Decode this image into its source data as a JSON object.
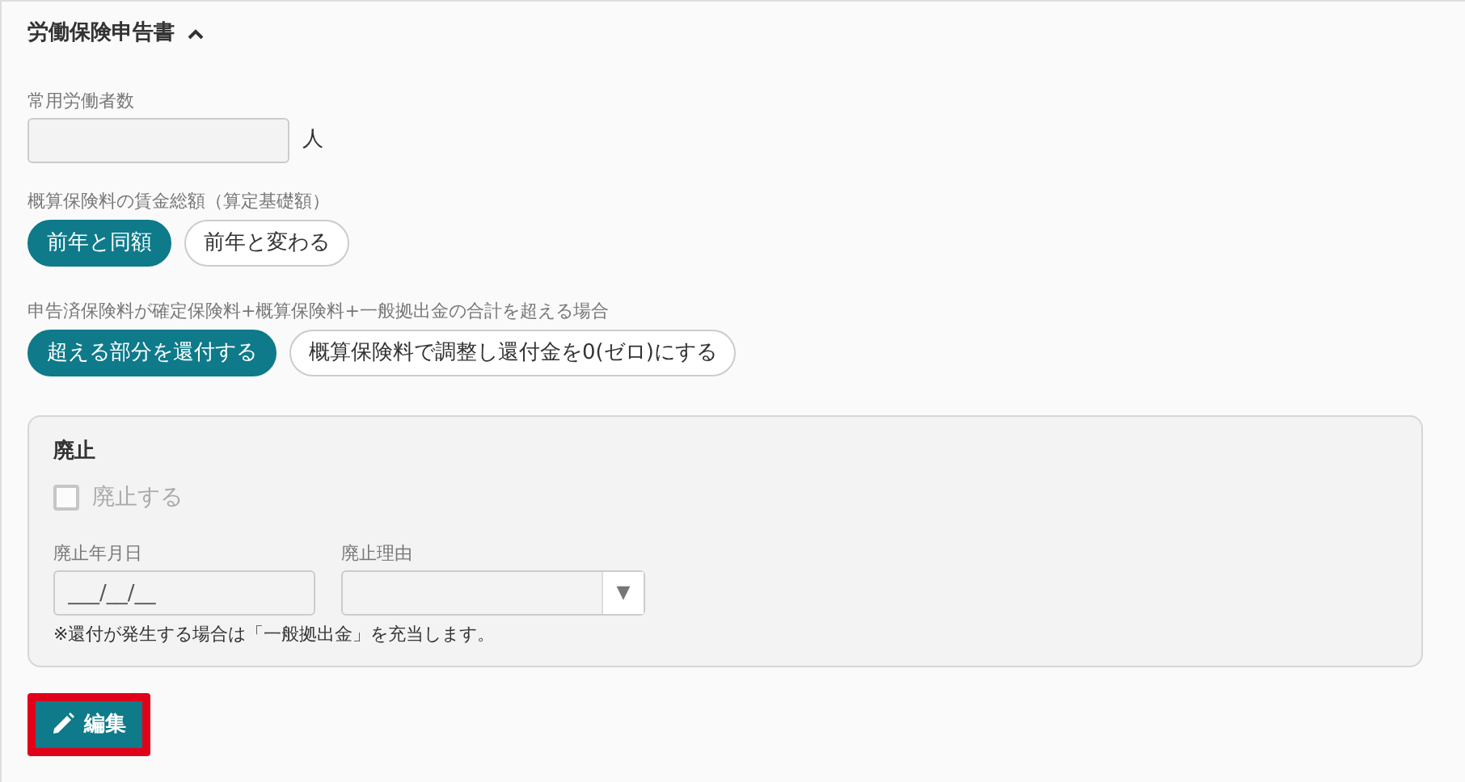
{
  "section": {
    "title": "労働保険申告書",
    "expanded": true
  },
  "workers": {
    "label": "常用労働者数",
    "unit": "人"
  },
  "groups": [
    {
      "label": "概算保険料の賃金総額（算定基礎額）",
      "options": [
        {
          "label": "前年と同額",
          "selected": true
        },
        {
          "label": "前年と変わる",
          "selected": false
        }
      ]
    },
    {
      "label": "申告済保険料が確定保険料+概算保険料+一般拠出金の合計を超える場合",
      "options": [
        {
          "label": "超える部分を還付する",
          "selected": true
        },
        {
          "label": "概算保険料で調整し還付金を0(ゼロ)にする",
          "selected": false
        }
      ]
    }
  ],
  "abolition": {
    "title": "廃止",
    "checkbox": {
      "label": "廃止する",
      "checked": false,
      "disabled": true
    },
    "date": {
      "label": "廃止年月日",
      "placeholder": "___/__/__"
    },
    "reason": {
      "label": "廃止理由",
      "caret": "▼"
    },
    "note": "※還付が発生する場合は「一般拠出金」を充当します。"
  },
  "edit_button": {
    "label": "編集",
    "highlighted": true
  }
}
